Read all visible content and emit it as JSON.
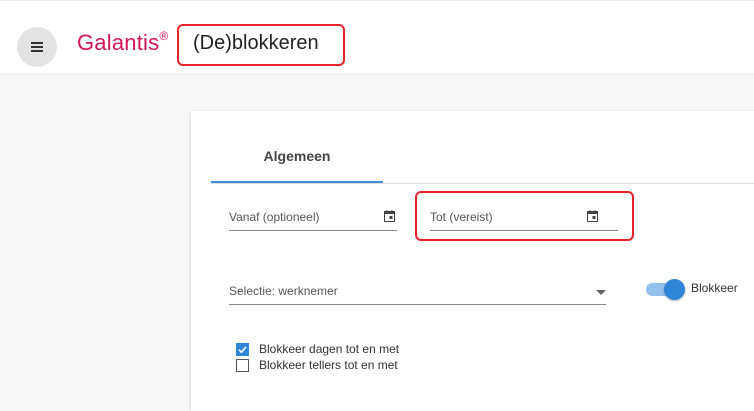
{
  "header": {
    "brand": "Galantis",
    "brand_mark": "®",
    "title": "(De)blokkeren"
  },
  "tabs": [
    {
      "label": "Algemeen",
      "active": true
    }
  ],
  "form": {
    "vanaf_placeholder": "Vanaf (optioneel)",
    "tot_placeholder": "Tot (vereist)",
    "selectie_placeholder": "Selectie: werknemer",
    "toggle_label": "Blokkeer",
    "toggle_on": true,
    "checkboxes": [
      {
        "label": "Blokkeer dagen tot en met",
        "checked": true
      },
      {
        "label": "Blokkeer tellers tot en met",
        "checked": false
      }
    ]
  },
  "colors": {
    "brand": "#d2145a",
    "accent": "#2f86d8",
    "highlight": "#e8232a"
  },
  "icons": {
    "menu": "menu-icon",
    "calendar": "calendar-icon",
    "dropdown": "chevron-down-icon",
    "check": "check-icon"
  }
}
